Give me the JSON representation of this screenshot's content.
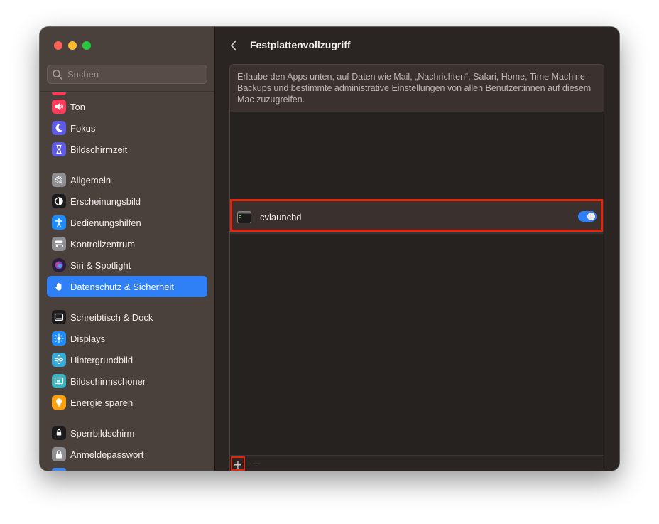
{
  "window": {
    "traffic_lights": [
      "close",
      "minimize",
      "maximize"
    ]
  },
  "sidebar": {
    "search_placeholder": "Suchen",
    "groups": [
      [
        {
          "label": "Ton",
          "icon": "speaker-icon",
          "color": "#ff3b5c"
        },
        {
          "label": "Fokus",
          "icon": "moon-icon",
          "color": "#5e5ce6"
        },
        {
          "label": "Bildschirmzeit",
          "icon": "hourglass-icon",
          "color": "#5e5ce6"
        }
      ],
      [
        {
          "label": "Allgemein",
          "icon": "gear-icon",
          "color": "#8e8e93"
        },
        {
          "label": "Erscheinungsbild",
          "icon": "appearance-icon",
          "color": "#1c1c1e"
        },
        {
          "label": "Bedienungshilfen",
          "icon": "accessibility-icon",
          "color": "#1a8cff"
        },
        {
          "label": "Kontrollzentrum",
          "icon": "toggles-icon",
          "color": "#8e8e93"
        },
        {
          "label": "Siri & Spotlight",
          "icon": "siri-icon",
          "color": "#7a3cc9"
        },
        {
          "label": "Datenschutz & Sicherheit",
          "icon": "hand-icon",
          "color": "#2f7ff6",
          "selected": true
        }
      ],
      [
        {
          "label": "Schreibtisch & Dock",
          "icon": "dock-icon",
          "color": "#1c1c1e"
        },
        {
          "label": "Displays",
          "icon": "sun-icon",
          "color": "#1a8cff"
        },
        {
          "label": "Hintergrundbild",
          "icon": "flower-icon",
          "color": "#34aadc"
        },
        {
          "label": "Bildschirmschoner",
          "icon": "screensaver-icon",
          "color": "#36b4c4"
        },
        {
          "label": "Energie sparen",
          "icon": "bulb-icon",
          "color": "#ff9f0a"
        }
      ],
      [
        {
          "label": "Sperrbildschirm",
          "icon": "lock-screen-icon",
          "color": "#1c1c1e"
        },
        {
          "label": "Anmeldepasswort",
          "icon": "lock-icon",
          "color": "#8e8e93"
        }
      ]
    ]
  },
  "main": {
    "back_label": "back",
    "title": "Festplattenvollzugriff",
    "description": "Erlaube den Apps unten, auf Daten wie Mail, „Nachrichten“, Safari, Home, Time Machine-Backups und bestimmte administrative Einstellungen von allen Benutzer:innen auf diesem Mac zuzugreifen.",
    "apps": [
      {
        "name": "cvlaunchd",
        "icon": "terminal-icon",
        "enabled": true
      }
    ],
    "add_label": "+",
    "remove_label": "−"
  },
  "colors": {
    "accent": "#2f7ff6",
    "highlight": "#e5250d"
  }
}
